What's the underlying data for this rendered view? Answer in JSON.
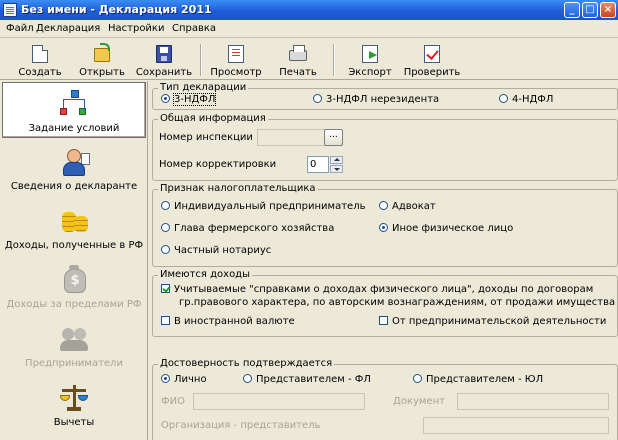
{
  "window": {
    "title": "Без имени - Декларация 2011",
    "minimize": "_",
    "maximize": "□",
    "close": "×"
  },
  "menu": [
    "Файл",
    "Декларация",
    "Настройки",
    "Справка"
  ],
  "toolbar": {
    "create": "Создать",
    "open": "Открыть",
    "save": "Сохранить",
    "preview": "Просмотр",
    "print": "Печать",
    "export": "Экспорт",
    "check": "Проверить"
  },
  "sidebar": {
    "items": [
      {
        "label": "Задание условий",
        "icon": "tree-icon",
        "active": true,
        "enabled": true
      },
      {
        "label": "Сведения о декларанте",
        "icon": "person-icon",
        "active": false,
        "enabled": true
      },
      {
        "label": "Доходы, полученные в РФ",
        "icon": "coins-icon",
        "active": false,
        "enabled": true
      },
      {
        "label": "Доходы за пределами РФ",
        "icon": "money-bag-icon",
        "active": false,
        "enabled": false
      },
      {
        "label": "Предприниматели",
        "icon": "people-icon",
        "active": false,
        "enabled": false
      },
      {
        "label": "Вычеты",
        "icon": "scales-icon",
        "active": false,
        "enabled": true
      }
    ]
  },
  "declaration_type": {
    "legend": "Тип декларации",
    "options": [
      "3-НДФЛ",
      "3-НДФЛ нерезидента",
      "4-НДФЛ"
    ],
    "selected": "3-НДФЛ"
  },
  "general_info": {
    "legend": "Общая информация",
    "inspection_label": "Номер инспекции",
    "inspection_value": "",
    "browse_button": "...",
    "correction_label": "Номер корректировки",
    "correction_value": "0"
  },
  "taxpayer": {
    "legend": "Признак налогоплательщика",
    "options": [
      "Индивидуальный предприниматель",
      "Адвокат",
      "Глава фермерского хозяйства",
      "Иное физическое лицо",
      "Частный нотариус"
    ],
    "selected": "Иное физическое лицо"
  },
  "income": {
    "legend": "Имеются доходы",
    "accounted_line1": "Учитываемые \"справками о доходах физического лица\", доходы по договорам",
    "accounted_line2": "гр.правового характера, по авторским вознаграждениям, от продажи имущества и др.",
    "accounted_checked": true,
    "foreign_currency": "В иностранной валюте",
    "foreign_checked": false,
    "business": "От предпринимательской деятельности",
    "business_checked": false
  },
  "confirmation": {
    "legend": "Достоверность подтверждается",
    "options": [
      "Лично",
      "Представителем - ФЛ",
      "Представителем - ЮЛ"
    ],
    "selected": "Лично",
    "fio_label": "ФИО",
    "document_label": "Документ",
    "org_label": "Организация - представитель"
  }
}
